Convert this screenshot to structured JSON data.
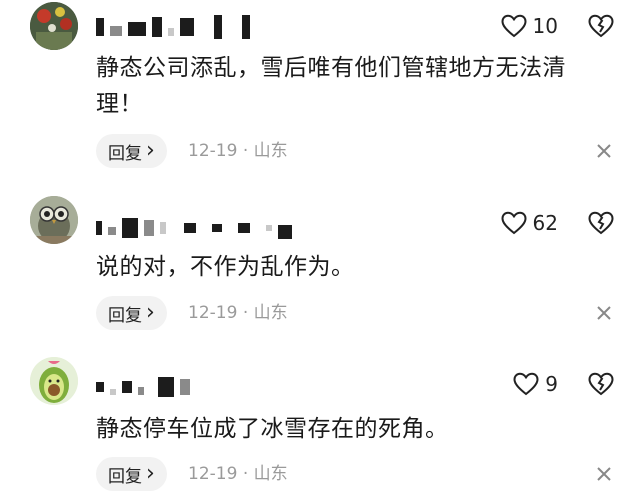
{
  "comments": [
    {
      "likes": "10",
      "text": "静态公司添乱，雪后唯有他们管辖地方无法清理！",
      "reply_label": "回复",
      "reply_chevron": "›",
      "date": "12-19",
      "separator": "·",
      "location": "山东",
      "avatar_icon": "flower-photo-avatar"
    },
    {
      "likes": "62",
      "text": "说的对，不作为乱作为。",
      "reply_label": "回复",
      "reply_chevron": "›",
      "date": "12-19",
      "separator": "·",
      "location": "山东",
      "avatar_icon": "owl-avatar"
    },
    {
      "likes": "9",
      "text": "静态停车位成了冰雪存在的死角。",
      "reply_label": "回复",
      "reply_chevron": "›",
      "date": "12-19",
      "separator": "·",
      "location": "山东",
      "avatar_icon": "avocado-avatar"
    }
  ],
  "icons": {
    "like": "heart-outline-icon",
    "dislike": "broken-heart-icon",
    "close": "close-x-icon"
  },
  "colors": {
    "text": "#1a1a1a",
    "meta": "#9a9a9a",
    "reply_bg": "#f2f2f2"
  }
}
